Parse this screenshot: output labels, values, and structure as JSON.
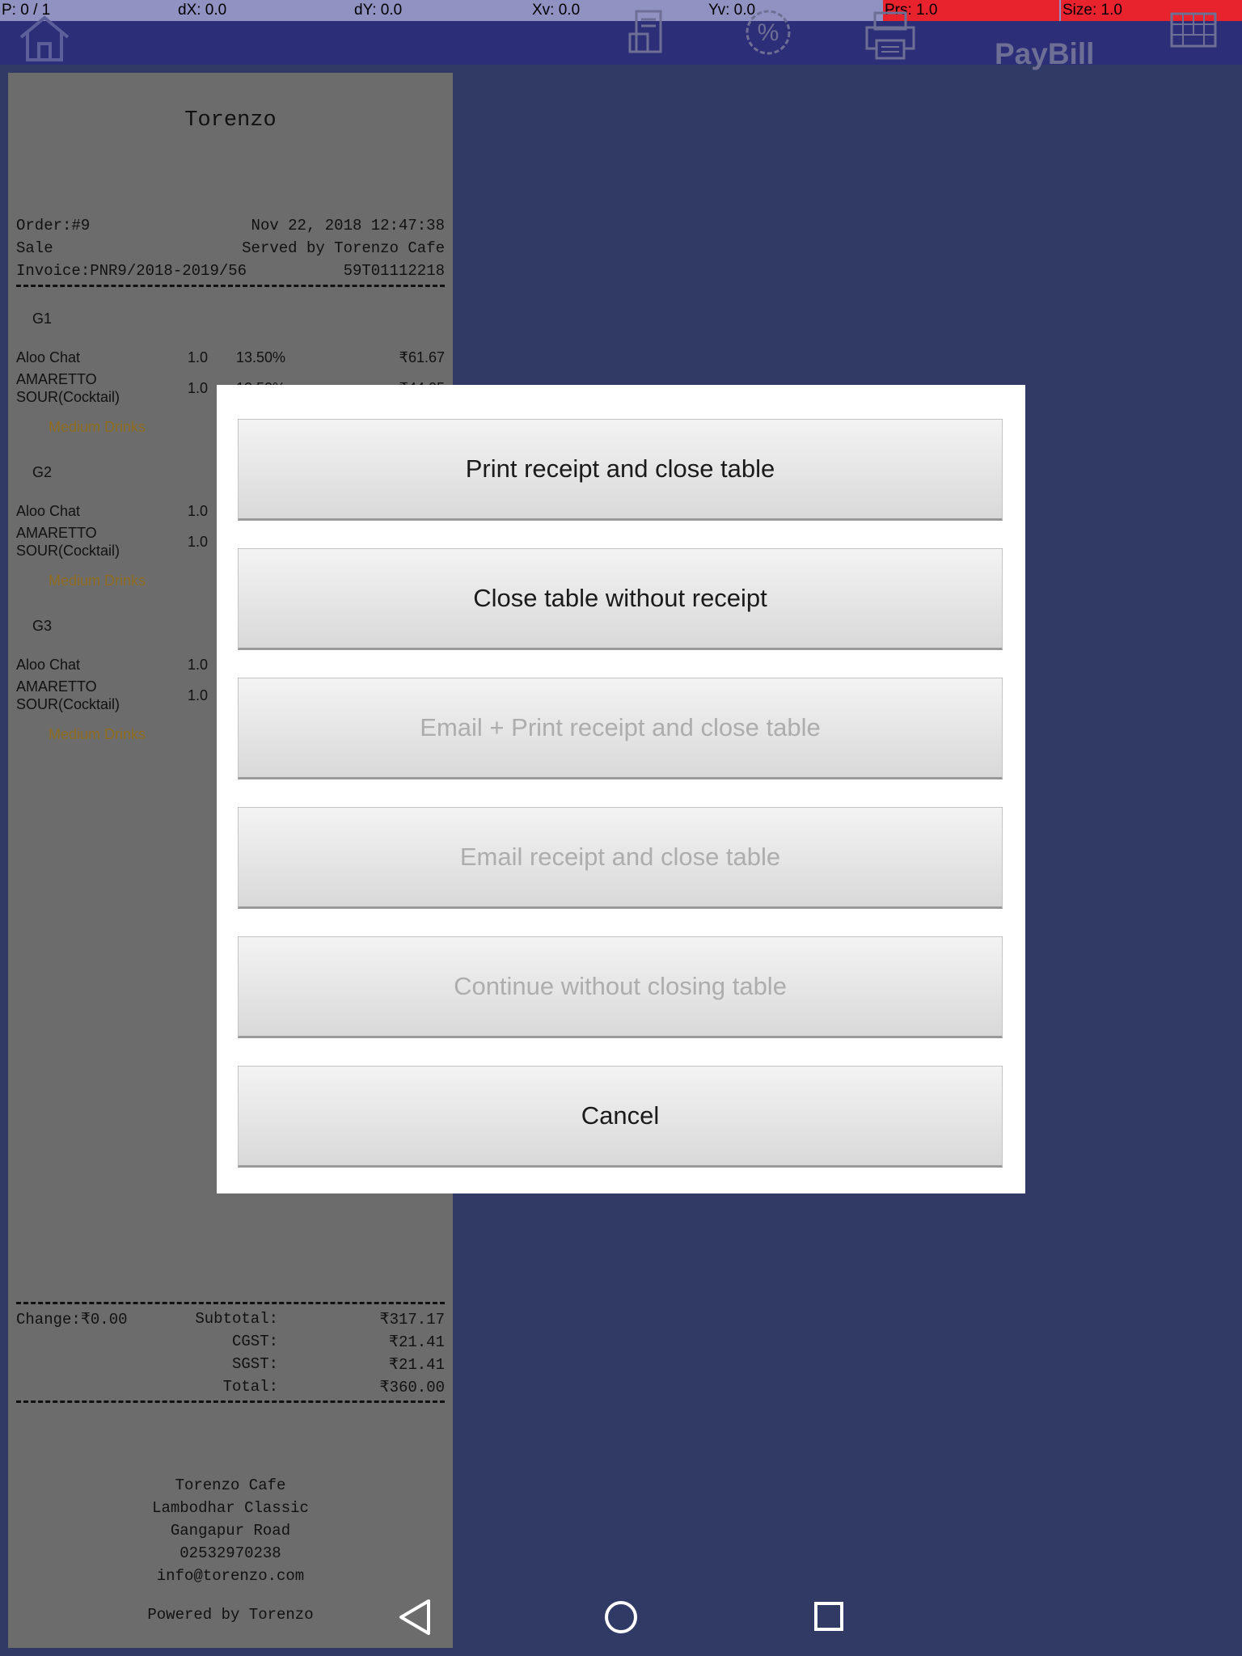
{
  "debug": {
    "p": "P: 0 / 1",
    "dx": "dX: 0.0",
    "dy": "dY: 0.0",
    "xv": "Xv: 0.0",
    "yv": "Yv: 0.0",
    "prs": "Prs: 1.0",
    "size": "Size: 1.0",
    "alert_color": "#e8232e"
  },
  "header": {
    "brand": "PayBill",
    "icons": [
      "home-icon",
      "receipt-icon",
      "discount-icon",
      "printer-icon",
      "keyboard-icon"
    ],
    "bg_color": "#2c2e78"
  },
  "receipt": {
    "store_name": "Torenzo",
    "order": "Order:#9",
    "datetime": "Nov 22, 2018 12:47:38",
    "type": "Sale",
    "served_by": "Served by Torenzo Cafe",
    "invoice": "Invoice:PNR9/2018-2019/56",
    "code": "59T01112218",
    "groups": [
      {
        "label": "G1",
        "items": [
          {
            "name": "Aloo Chat",
            "qty": "1.0",
            "tax": "13.50%",
            "price": "₹61.67"
          },
          {
            "name": "AMARETTO SOUR(Cocktail)",
            "qty": "1.0",
            "tax": "13.50%",
            "price": "₹44.05"
          }
        ],
        "modifier": "Medium Drinks"
      },
      {
        "label": "G2",
        "items": [
          {
            "name": "Aloo Chat",
            "qty": "1.0"
          },
          {
            "name": "AMARETTO SOUR(Cocktail)",
            "qty": "1.0"
          }
        ],
        "modifier": "Medium Drinks"
      },
      {
        "label": "G3",
        "items": [
          {
            "name": "Aloo Chat",
            "qty": "1.0"
          },
          {
            "name": "AMARETTO SOUR(Cocktail)",
            "qty": "1.0"
          }
        ],
        "modifier": "Medium Drinks"
      }
    ],
    "totals": {
      "change": "Change:₹0.00",
      "subtotal_label": "Subtotal:",
      "subtotal": "₹317.17",
      "cgst_label": "CGST:",
      "cgst": "₹21.41",
      "sgst_label": "SGST:",
      "sgst": "₹21.41",
      "total_label": "Total:",
      "total": "₹360.00"
    },
    "footer": {
      "name": "Torenzo Cafe",
      "addr1": "Lambodhar Classic",
      "addr2": "Gangapur Road",
      "phone": "02532970238",
      "email": "info@torenzo.com",
      "powered": "Powered by Torenzo"
    }
  },
  "dialog": {
    "buttons": [
      {
        "label": "Print receipt and close table",
        "enabled": true
      },
      {
        "label": "Close table without receipt",
        "enabled": true
      },
      {
        "label": "Email + Print receipt and close table",
        "enabled": false
      },
      {
        "label": "Email receipt and close table",
        "enabled": false
      },
      {
        "label": "Continue without closing table",
        "enabled": false
      },
      {
        "label": "Cancel",
        "enabled": true
      }
    ]
  },
  "navbar": {
    "icons": [
      "back-icon",
      "home-circle-icon",
      "recents-icon"
    ]
  }
}
